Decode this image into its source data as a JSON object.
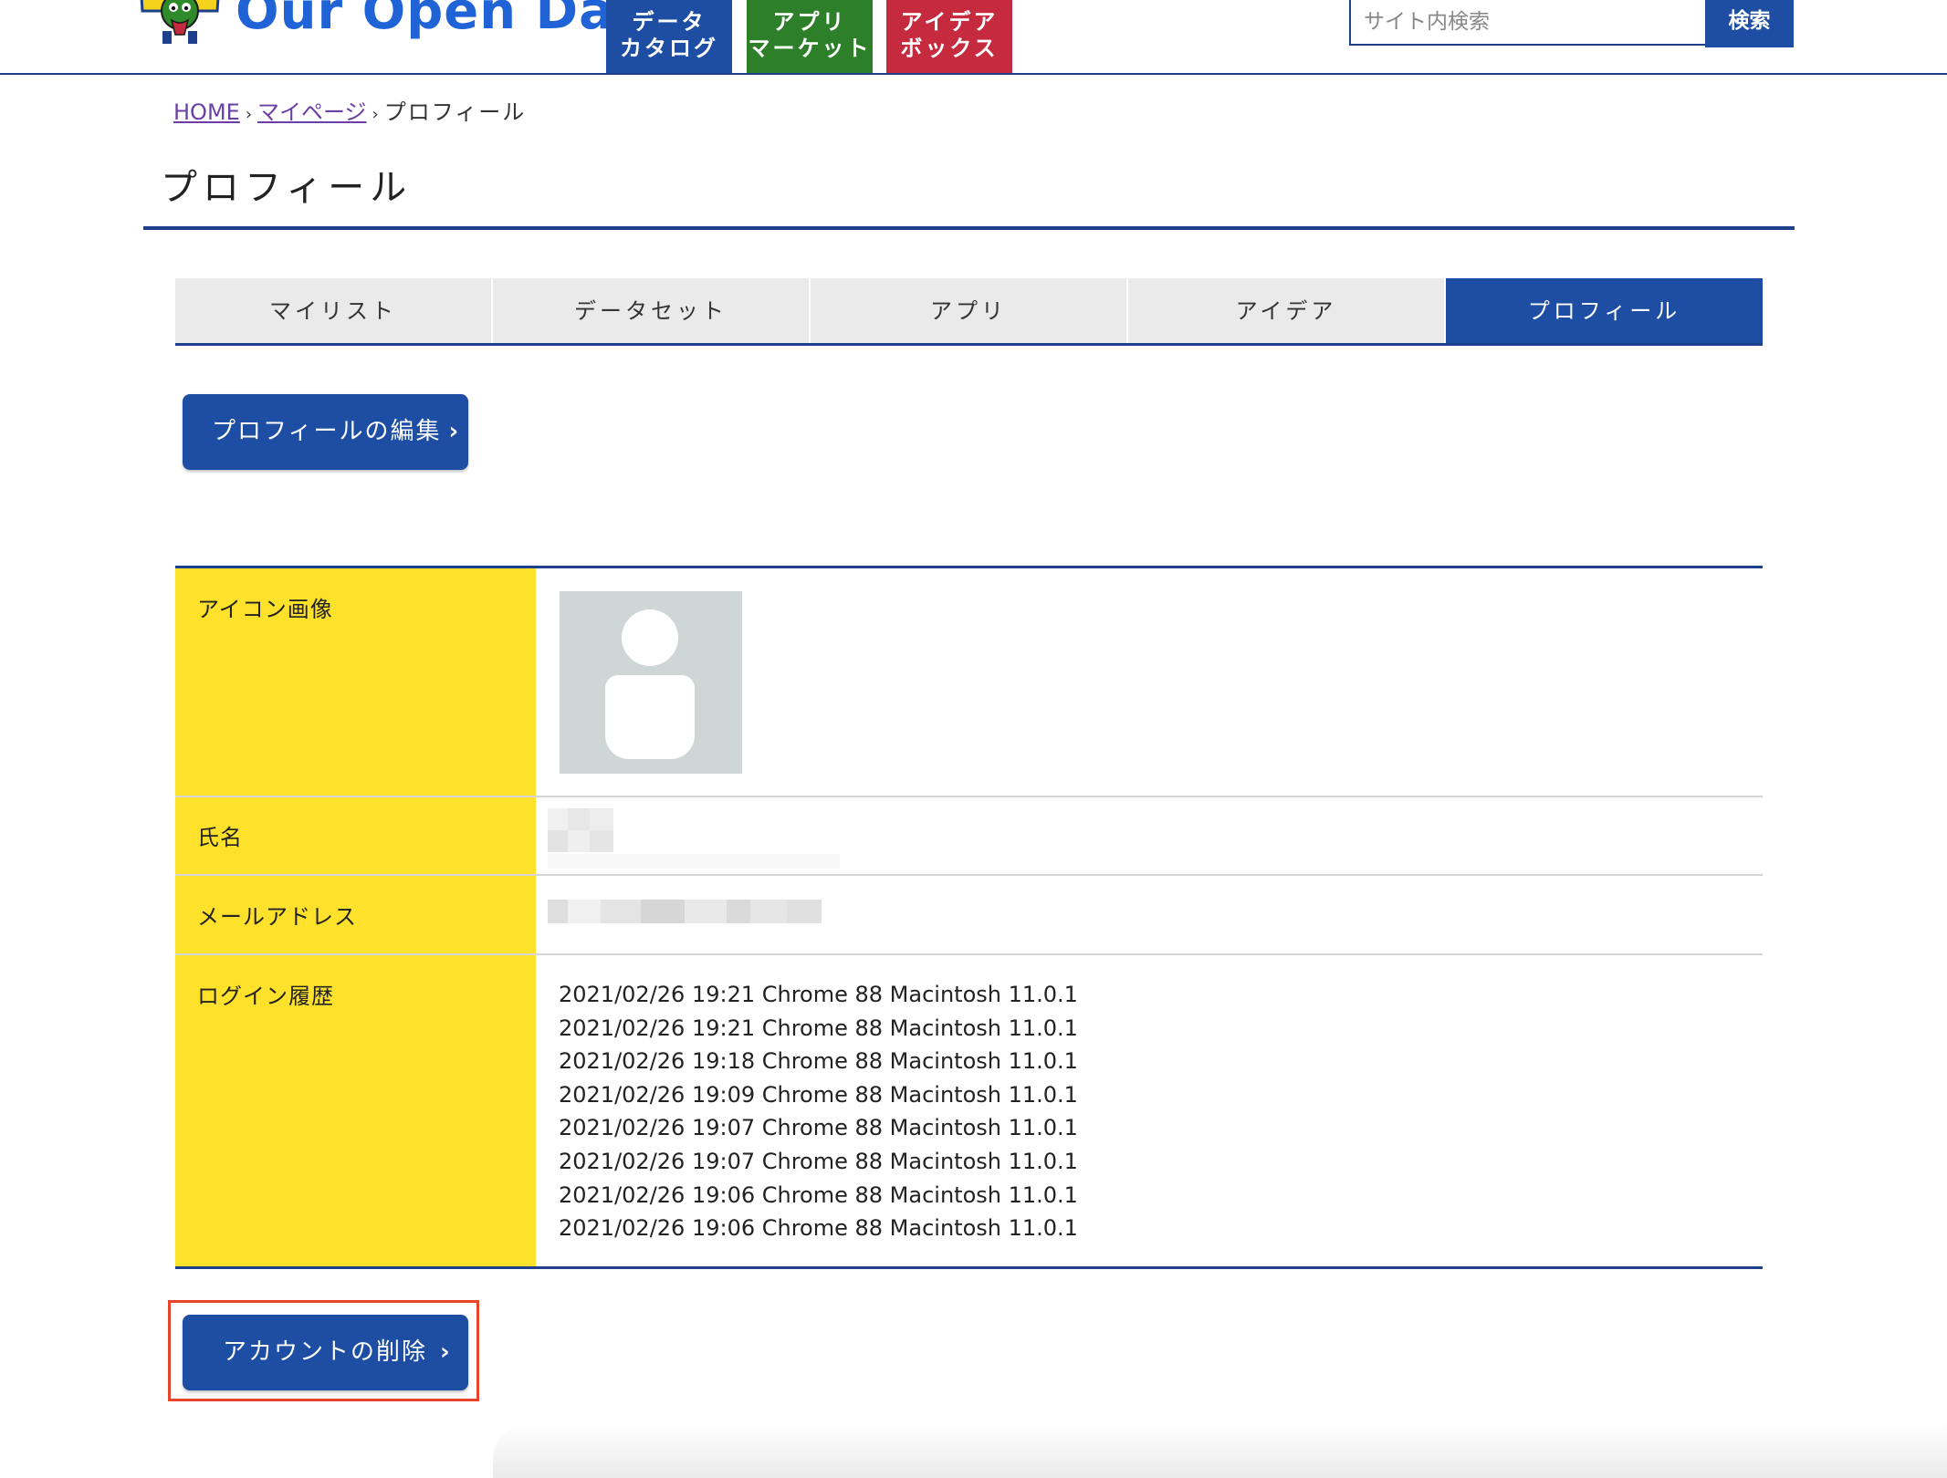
{
  "header": {
    "logo_text": "Our Open Data",
    "nav": [
      {
        "line1": "データ",
        "line2": "カタログ",
        "color": "#1d4ea3"
      },
      {
        "line1": "アプリ",
        "line2": "マーケット",
        "color": "#2e7f2a"
      },
      {
        "line1": "アイデア",
        "line2": "ボックス",
        "color": "#c62a3e"
      }
    ],
    "search": {
      "placeholder": "サイト内検索",
      "button_label": "検索"
    }
  },
  "breadcrumb": {
    "home": "HOME",
    "mypage": "マイページ",
    "current": "プロフィール"
  },
  "page_title": "プロフィール",
  "tabs": [
    {
      "label": "マイリスト",
      "active": false
    },
    {
      "label": "データセット",
      "active": false
    },
    {
      "label": "アプリ",
      "active": false
    },
    {
      "label": "アイデア",
      "active": false
    },
    {
      "label": "プロフィール",
      "active": true
    }
  ],
  "edit_button_label": "プロフィールの編集",
  "profile": {
    "icon_label": "アイコン画像",
    "name_label": "氏名",
    "email_label": "メールアドレス",
    "login_history_label": "ログイン履歴",
    "login_history": [
      "2021/02/26 19:21 Chrome 88 Macintosh 11.0.1",
      "2021/02/26 19:21 Chrome 88 Macintosh 11.0.1",
      "2021/02/26 19:18 Chrome 88 Macintosh 11.0.1",
      "2021/02/26 19:09 Chrome 88 Macintosh 11.0.1",
      "2021/02/26 19:07 Chrome 88 Macintosh 11.0.1",
      "2021/02/26 19:07 Chrome 88 Macintosh 11.0.1",
      "2021/02/26 19:06 Chrome 88 Macintosh 11.0.1",
      "2021/02/26 19:06 Chrome 88 Macintosh 11.0.1"
    ]
  },
  "delete_button_label": "アカウントの削除",
  "colors": {
    "primary_blue": "#1d4ea3",
    "label_yellow": "#fde12a",
    "highlight_red": "#e8432b"
  }
}
